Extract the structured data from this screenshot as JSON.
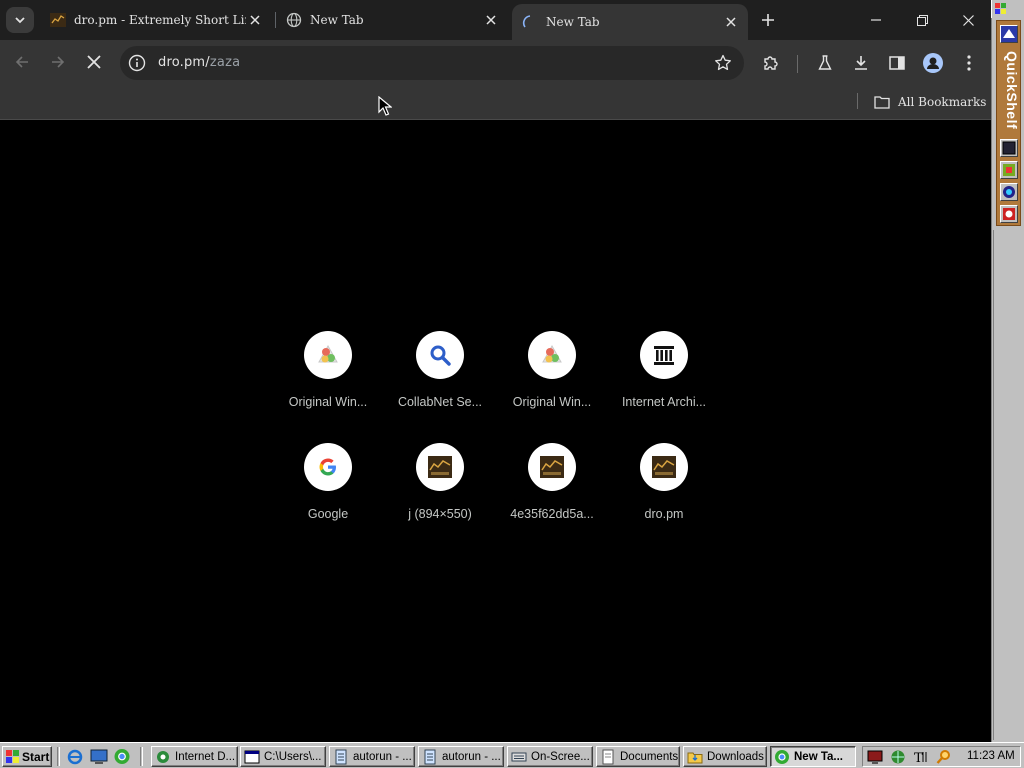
{
  "browser": {
    "tabs": [
      {
        "title": "dro.pm - Extremely Short Link",
        "favicon": "dro-pm-favicon",
        "active": false
      },
      {
        "title": "New Tab",
        "favicon": "globe-icon",
        "active": false
      },
      {
        "title": "New Tab",
        "favicon": "loading-icon",
        "active": true
      }
    ],
    "address": {
      "host": "dro.pm/",
      "path": "zaza"
    },
    "bookmarks_bar": {
      "all_bookmarks_label": "All Bookmarks"
    },
    "shortcuts": [
      {
        "label": "Original Win...",
        "icon": "original-win-icon"
      },
      {
        "label": "CollabNet Se...",
        "icon": "magnifier-icon"
      },
      {
        "label": "Original Win...",
        "icon": "original-win-icon"
      },
      {
        "label": "Internet Archi...",
        "icon": "archive-building-icon"
      },
      {
        "label": "Google",
        "icon": "google-g-icon"
      },
      {
        "label": "j (894×550)",
        "icon": "dro-pm-icon"
      },
      {
        "label": "4e35f62dd5a...",
        "icon": "dro-pm-icon"
      },
      {
        "label": "dro.pm",
        "icon": "dro-pm-icon"
      }
    ]
  },
  "quickshelf": {
    "title": "QuickShelf"
  },
  "taskbar": {
    "start_label": "Start",
    "tasks": [
      {
        "label": "Internet D...",
        "icon": "ie-icon"
      },
      {
        "label": "C:\\Users\\...",
        "icon": "folder-window-icon"
      },
      {
        "label": "autorun - ...",
        "icon": "notepad-icon"
      },
      {
        "label": "autorun - ...",
        "icon": "notepad-icon"
      },
      {
        "label": "On-Scree...",
        "icon": "keyboard-icon"
      },
      {
        "label": "Documents",
        "icon": "document-folder-icon"
      },
      {
        "label": "Downloads",
        "icon": "downloads-folder-icon"
      },
      {
        "label": "New Ta...",
        "icon": "chrome-icon"
      }
    ],
    "clock": "11:23 AM"
  },
  "colors": {
    "tabstrip": "#1f1f1f",
    "toolbar": "#353535",
    "content": "#000000",
    "win98_gray": "#c0c0c0",
    "quickshelf_brown": "#b0793b"
  }
}
